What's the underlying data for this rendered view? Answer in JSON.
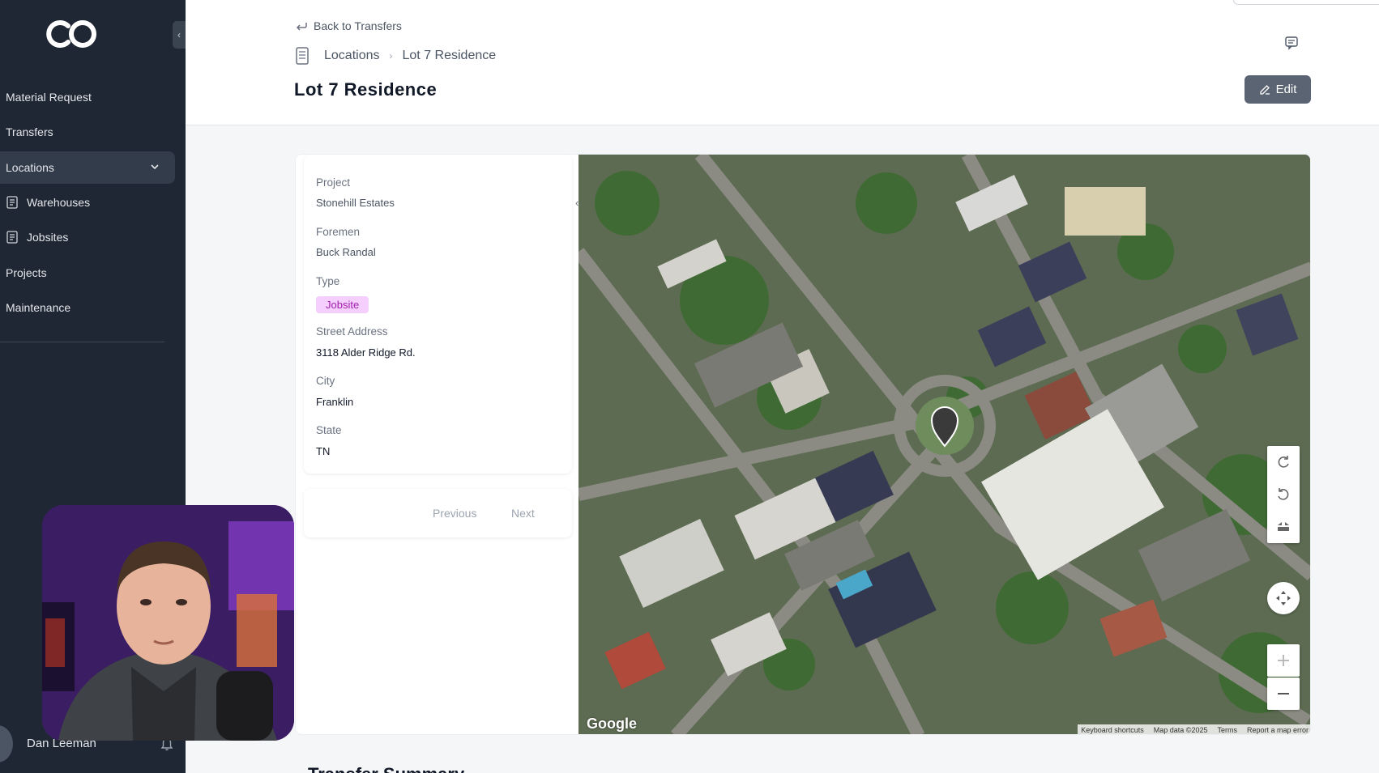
{
  "sidebar": {
    "collapse_label": "‹",
    "items": [
      {
        "label": "Material Request"
      },
      {
        "label": "Transfers"
      },
      {
        "label": "Locations"
      },
      {
        "label": "Warehouses"
      },
      {
        "label": "Jobsites"
      },
      {
        "label": "Projects"
      },
      {
        "label": "Maintenance"
      }
    ],
    "user_name": "Dan Leeman"
  },
  "header": {
    "back_label": "Back to Transfers",
    "breadcrumb": [
      "Locations",
      "Lot 7 Residence"
    ],
    "title": "Lot 7 Residence",
    "edit_label": "Edit"
  },
  "details": {
    "fields": [
      {
        "label": "Project",
        "value": "Stonehill Estates"
      },
      {
        "label": "Foremen",
        "value": "Buck Randal"
      },
      {
        "label": "Type",
        "value": "Jobsite"
      },
      {
        "label": "Street Address",
        "value": "3118 Alder Ridge Rd."
      },
      {
        "label": "City",
        "value": "Franklin"
      },
      {
        "label": "State",
        "value": "TN"
      }
    ],
    "collapse_label": "‹"
  },
  "pager": {
    "previous": "Previous",
    "next": "Next"
  },
  "map": {
    "logo": "Google",
    "attribution": [
      "Keyboard shortcuts",
      "Map data ©2025",
      "Terms",
      "Report a map error"
    ]
  },
  "section_title": "Transfer Summary",
  "colors": {
    "sidebar_bg": "#1e2733",
    "badge_bg": "#f5d0fe",
    "badge_text": "#a21caf",
    "edit_btn": "#5b6472"
  }
}
